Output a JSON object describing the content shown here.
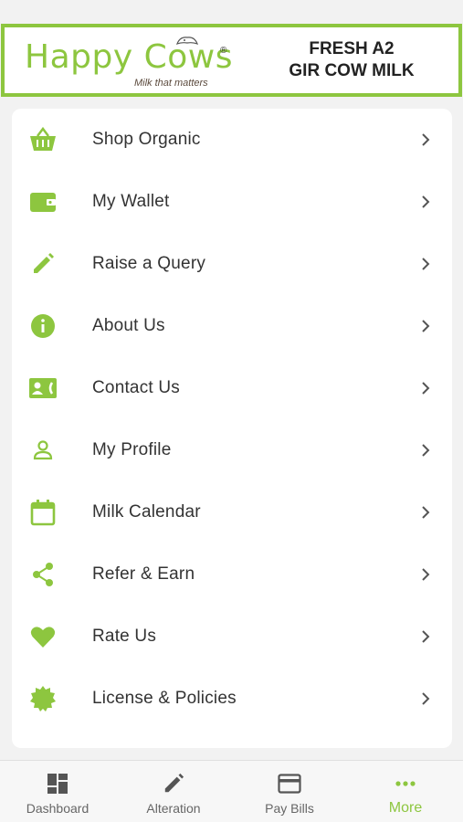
{
  "banner": {
    "brand": "Happy Cows",
    "registered": "®",
    "tagline": "Milk that matters",
    "headline_line1": "FRESH A2",
    "headline_line2": "GIR COW MILK"
  },
  "menu": {
    "items": [
      {
        "label": "Shop Organic",
        "icon": "basket-icon"
      },
      {
        "label": "My Wallet",
        "icon": "wallet-icon"
      },
      {
        "label": "Raise a Query",
        "icon": "pencil-icon"
      },
      {
        "label": "About Us",
        "icon": "info-icon"
      },
      {
        "label": "Contact Us",
        "icon": "contact-card-icon"
      },
      {
        "label": "My Profile",
        "icon": "person-icon"
      },
      {
        "label": "Milk Calendar",
        "icon": "calendar-icon"
      },
      {
        "label": "Refer & Earn",
        "icon": "share-icon"
      },
      {
        "label": "Rate Us",
        "icon": "heart-icon"
      },
      {
        "label": "License & Policies",
        "icon": "seal-icon"
      }
    ]
  },
  "tabbar": {
    "tabs": [
      {
        "label": "Dashboard",
        "icon": "dashboard-icon"
      },
      {
        "label": "Alteration",
        "icon": "pencil-icon"
      },
      {
        "label": "Pay Bills",
        "icon": "card-icon"
      },
      {
        "label": "More",
        "icon": "more-dots-icon",
        "active": true
      }
    ]
  },
  "colors": {
    "accent": "#8dc63f",
    "text": "#333333",
    "muted": "#666666",
    "background": "#f2f2f2"
  }
}
